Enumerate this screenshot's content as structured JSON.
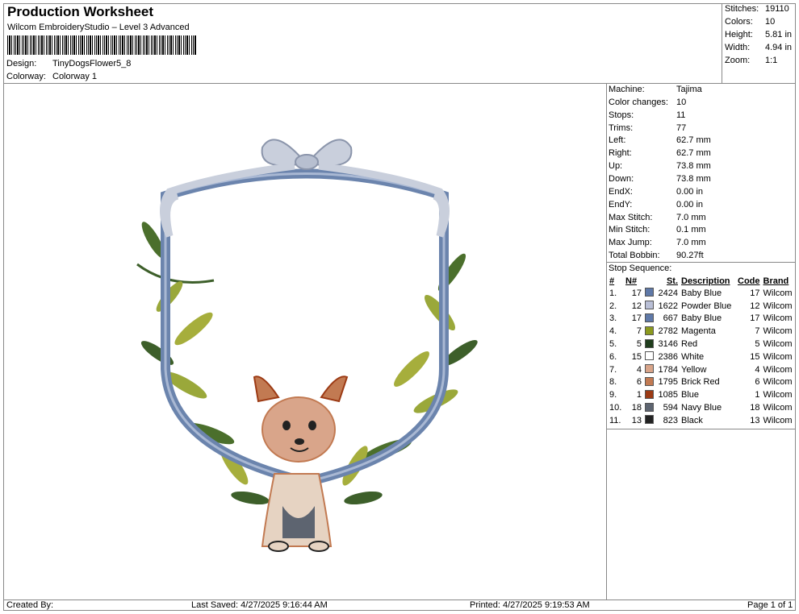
{
  "header": {
    "title": "Production Worksheet",
    "subtitle": "Wilcom EmbroideryStudio – Level 3 Advanced",
    "design_label": "Design:",
    "design_value": "TinyDogsFlower5_8",
    "colorway_label": "Colorway:",
    "colorway_value": "Colorway 1"
  },
  "stats": [
    {
      "label": "Stitches:",
      "value": "19110"
    },
    {
      "label": "Colors:",
      "value": "10"
    },
    {
      "label": "Height:",
      "value": "5.81 in"
    },
    {
      "label": "Width:",
      "value": "4.94 in"
    },
    {
      "label": "Zoom:",
      "value": "1:1"
    }
  ],
  "details": [
    {
      "label": "Machine:",
      "value": "Tajima"
    },
    {
      "label": "Color changes:",
      "value": "10"
    },
    {
      "label": "Stops:",
      "value": "11"
    },
    {
      "label": "Trims:",
      "value": "77"
    },
    {
      "label": "Left:",
      "value": "62.7 mm"
    },
    {
      "label": "Right:",
      "value": "62.7 mm"
    },
    {
      "label": "Up:",
      "value": "73.8 mm"
    },
    {
      "label": "Down:",
      "value": "73.8 mm"
    },
    {
      "label": "EndX:",
      "value": "0.00 in"
    },
    {
      "label": "EndY:",
      "value": "0.00 in"
    },
    {
      "label": "Max Stitch:",
      "value": "7.0 mm"
    },
    {
      "label": "Min Stitch:",
      "value": "0.1 mm"
    },
    {
      "label": "Max Jump:",
      "value": "7.0 mm"
    },
    {
      "label": "Total Bobbin:",
      "value": "90.27ft"
    }
  ],
  "stop_sequence": {
    "title": "Stop Sequence:",
    "headers": {
      "index": "#",
      "needle": "N#",
      "stitches": "St.",
      "description": "Description",
      "code": "Code",
      "brand": "Brand"
    },
    "rows": [
      {
        "index": "1.",
        "needle": "17",
        "color": "#5f79a8",
        "stitches": "2424",
        "description": "Baby Blue",
        "code": "17",
        "brand": "Wilcom"
      },
      {
        "index": "2.",
        "needle": "12",
        "color": "#b9bfd6",
        "stitches": "1622",
        "description": "Powder Blue",
        "code": "12",
        "brand": "Wilcom"
      },
      {
        "index": "3.",
        "needle": "17",
        "color": "#5f79a8",
        "stitches": "667",
        "description": "Baby Blue",
        "code": "17",
        "brand": "Wilcom"
      },
      {
        "index": "4.",
        "needle": "7",
        "color": "#8c9a1e",
        "stitches": "2782",
        "description": "Magenta",
        "code": "7",
        "brand": "Wilcom"
      },
      {
        "index": "5.",
        "needle": "5",
        "color": "#1f3d1c",
        "stitches": "3146",
        "description": "Red",
        "code": "5",
        "brand": "Wilcom"
      },
      {
        "index": "6.",
        "needle": "15",
        "color": "#ffffff",
        "stitches": "2386",
        "description": "White",
        "code": "15",
        "brand": "Wilcom"
      },
      {
        "index": "7.",
        "needle": "4",
        "color": "#d9a58a",
        "stitches": "1784",
        "description": "Yellow",
        "code": "4",
        "brand": "Wilcom"
      },
      {
        "index": "8.",
        "needle": "6",
        "color": "#c27a52",
        "stitches": "1795",
        "description": "Brick Red",
        "code": "6",
        "brand": "Wilcom"
      },
      {
        "index": "9.",
        "needle": "1",
        "color": "#9c3a14",
        "stitches": "1085",
        "description": "Blue",
        "code": "1",
        "brand": "Wilcom"
      },
      {
        "index": "10.",
        "needle": "18",
        "color": "#5d6470",
        "stitches": "594",
        "description": "Navy Blue",
        "code": "18",
        "brand": "Wilcom"
      },
      {
        "index": "11.",
        "needle": "13",
        "color": "#222222",
        "stitches": "823",
        "description": "Black",
        "code": "13",
        "brand": "Wilcom"
      }
    ]
  },
  "footer": {
    "created_by": "Created By:",
    "last_saved": "Last Saved: 4/27/2025 9:16:44 AM",
    "printed": "Printed: 4/27/2025 9:19:53 AM",
    "page": "Page 1 of 1"
  }
}
